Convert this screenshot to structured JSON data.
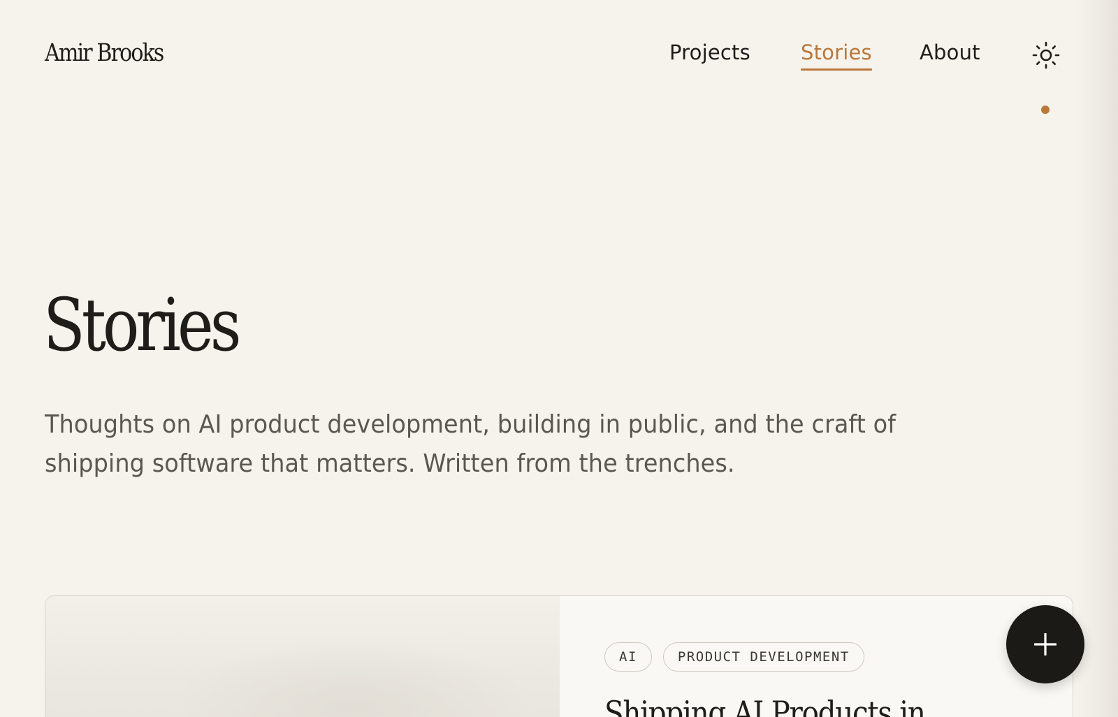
{
  "header": {
    "logo": "Amir Brooks",
    "nav": [
      {
        "label": "Projects",
        "active": false
      },
      {
        "label": "Stories",
        "active": true
      },
      {
        "label": "About",
        "active": false
      }
    ],
    "theme_toggle_icon": "sun-icon",
    "accent_color": "#b9773a"
  },
  "main": {
    "title": "Stories",
    "intro": "Thoughts on AI product development, building in public, and the craft of shipping software that matters. Written from the trenches."
  },
  "featured_story": {
    "tags": [
      "AI",
      "PRODUCT DEVELOPMENT"
    ],
    "title": "Shipping AI Products in"
  },
  "fab": {
    "icon": "plus-icon"
  }
}
